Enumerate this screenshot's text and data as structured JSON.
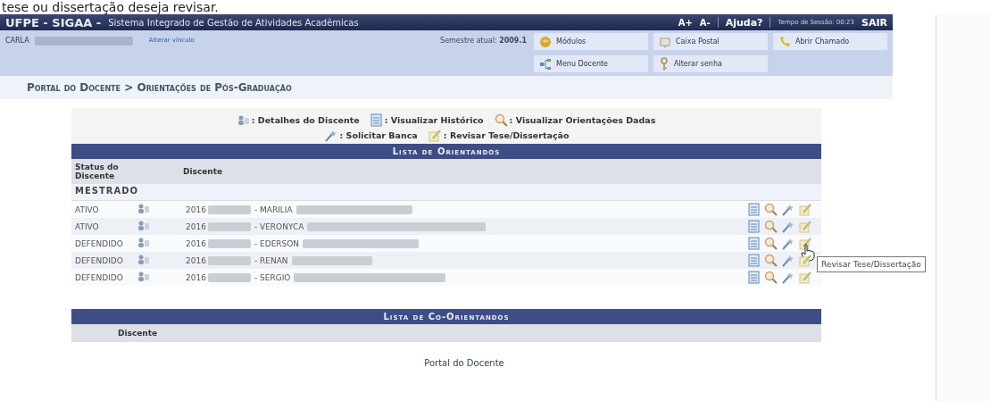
{
  "caption": "tese ou dissertação deseja revisar.",
  "header": {
    "brand": "UFPE - SIGAA -",
    "system": "Sistema Integrado de Gestão de Atividades Acadêmicas",
    "font_up": "A+",
    "font_down": "A-",
    "help": "Ajuda?",
    "session": "Tempo de Sessão: 00:23",
    "logout": "SAIR"
  },
  "user": {
    "name": "CARLA",
    "change_link": "Alterar vínculo",
    "semester_label": "Semestre atual:",
    "semester": "2009.1"
  },
  "menu": [
    {
      "label": "Módulos",
      "kind": "cube"
    },
    {
      "label": "Caixa Postal",
      "kind": "mailbox"
    },
    {
      "label": "Abrir Chamado",
      "kind": "phone"
    },
    {
      "label": "Menu Docente",
      "kind": "tree"
    },
    {
      "label": "Alterar senha",
      "kind": "key"
    }
  ],
  "breadcrumb": "Portal do Docente > Orientações de Pós-Graduação",
  "legend": [
    {
      "kind": "detail",
      "label": ": Detalhes do Discente"
    },
    {
      "kind": "history",
      "label": ": Visualizar Histórico"
    },
    {
      "kind": "search",
      "label": ": Visualizar Orientações Dadas"
    },
    {
      "kind": "wand",
      "label": ": Solicitar Banca"
    },
    {
      "kind": "pencil",
      "label": ": Revisar Tese/Dissertação"
    }
  ],
  "advisees": {
    "title": "Lista de Orientandos",
    "columns": [
      "Status do Discente",
      "Discente"
    ],
    "group": "MESTRADO",
    "rows": [
      {
        "status": "ATIVO",
        "id": "2016",
        "name": "- MARILIA",
        "hovered": false
      },
      {
        "status": "ATIVO",
        "id": "2016",
        "name": "- VERONYCA",
        "hovered": false
      },
      {
        "status": "DEFENDIDO",
        "id": "2016",
        "name": "- EDERSON",
        "hovered": true
      },
      {
        "status": "DEFENDIDO",
        "id": "2016",
        "name": "- RENAN",
        "hovered": false
      },
      {
        "status": "DEFENDIDO",
        "id": "2016",
        "name": "- SERGIO",
        "hovered": false
      }
    ]
  },
  "tooltip": "Revisar Tese/Dissertação",
  "co_advisees": {
    "title": "Lista de Co-Orientandos",
    "columns": [
      "Discente"
    ]
  },
  "footer_link": "Portal do Docente"
}
